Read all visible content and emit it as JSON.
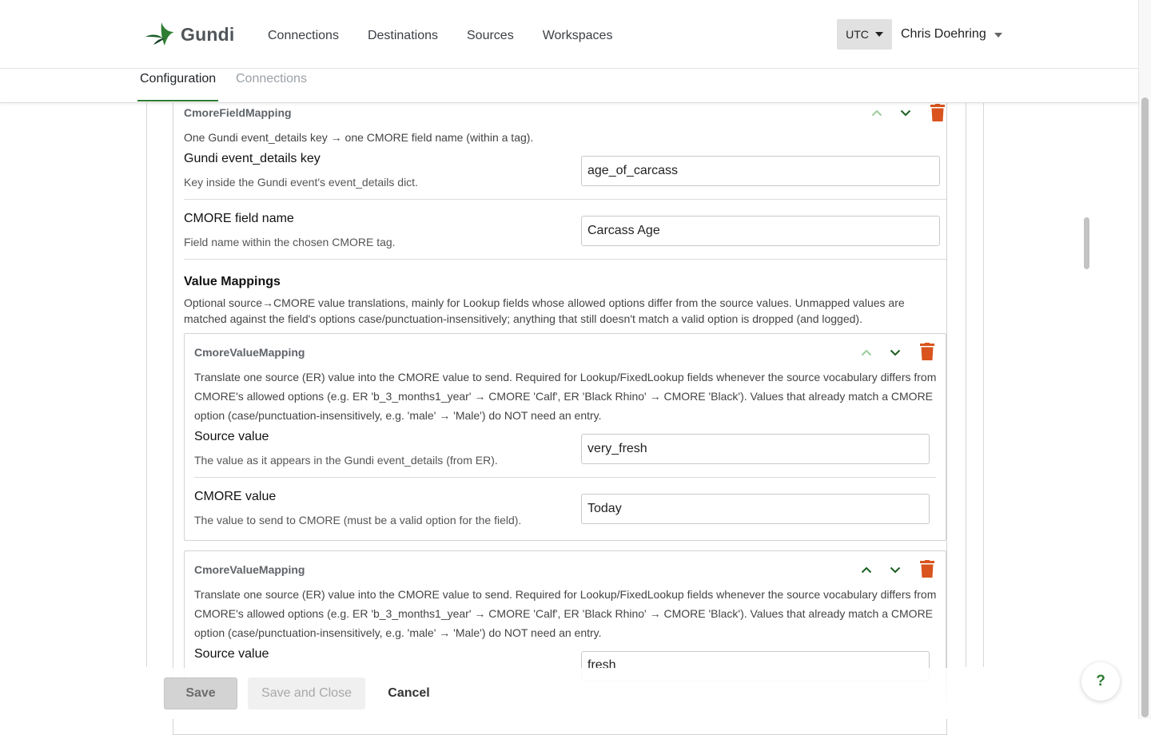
{
  "app": {
    "name": "Gundi",
    "nav": [
      "Connections",
      "Destinations",
      "Sources",
      "Workspaces"
    ],
    "timezone": "UTC",
    "user": "Chris Doehring"
  },
  "tabs": {
    "active": "Configuration",
    "inactive": "Connections"
  },
  "field_mapping": {
    "title": "CmoreFieldMapping",
    "description": "One Gundi event_details key → one CMORE field name (within a tag).",
    "key_label": "Gundi event_details key",
    "key_help": "Key inside the Gundi event's event_details dict.",
    "key_value": "age_of_carcass",
    "field_label": "CMORE field name",
    "field_help": "Field name within the chosen CMORE tag.",
    "field_value": "Carcass Age"
  },
  "value_mappings": {
    "heading": "Value Mappings",
    "description": "Optional source→CMORE value translations, mainly for Lookup fields whose allowed options differ from the source values. Unmapped values are matched against the field's options case/punctuation-insensitively; anything that still doesn't match a valid option is dropped (and logged).",
    "items": [
      {
        "title": "CmoreValueMapping",
        "description": "Translate one source (ER) value into the CMORE value to send. Required for Lookup/FixedLookup fields whenever the source vocabulary differs from CMORE's allowed options (e.g. ER 'b_3_months1_year' → CMORE 'Calf', ER 'Black Rhino' → CMORE 'Black'). Values that already match a CMORE option (case/punctuation-insensitively, e.g. 'male' → 'Male') do NOT need an entry.",
        "source_label": "Source value",
        "source_help": "The value as it appears in the Gundi event_details (from ER).",
        "source_value": "very_fresh",
        "cmore_label": "CMORE value",
        "cmore_help": "The value to send to CMORE (must be a valid option for the field).",
        "cmore_value": "Today"
      },
      {
        "title": "CmoreValueMapping",
        "description": "Translate one source (ER) value into the CMORE value to send. Required for Lookup/FixedLookup fields whenever the source vocabulary differs from CMORE's allowed options (e.g. ER 'b_3_months1_year' → CMORE 'Calf', ER 'Black Rhino' → CMORE 'Black'). Values that already match a CMORE option (case/punctuation-insensitively, e.g. 'male' → 'Male') do NOT need an entry.",
        "source_label": "Source value",
        "source_value": "fresh"
      }
    ]
  },
  "footer": {
    "save": "Save",
    "save_close": "Save and Close",
    "cancel": "Cancel"
  },
  "help": "?",
  "colors": {
    "accent_green": "#2e7d32",
    "trash_orange": "#d9541e",
    "disabled_arrow": "#9ccc9c"
  }
}
